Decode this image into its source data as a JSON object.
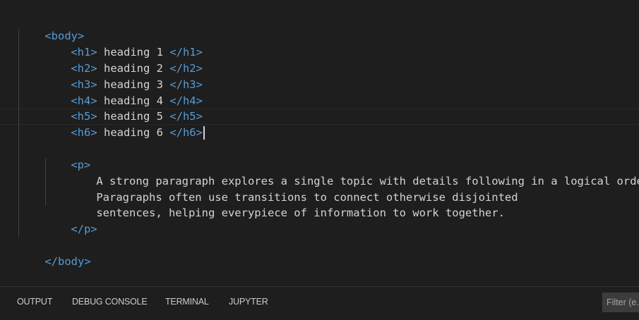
{
  "editor": {
    "lines": [
      {
        "open": "<body>"
      },
      {
        "open": "<h1>",
        "content": " heading 1 ",
        "close": "</h1>"
      },
      {
        "open": "<h2>",
        "content": " heading 2 ",
        "close": "</h2>"
      },
      {
        "open": "<h3>",
        "content": " heading 3 ",
        "close": "</h3>"
      },
      {
        "open": "<h4>",
        "content": " heading 4 ",
        "close": "</h4>"
      },
      {
        "open": "<h5>",
        "content": " heading 5 ",
        "close": "</h5>"
      },
      {
        "open": "<h6>",
        "content": " heading 6 ",
        "close": "</h6>"
      },
      {
        "open": "<p>"
      },
      {
        "content": "A strong paragraph explores a single topic with details following in a logical order."
      },
      {
        "content": "Paragraphs often use transitions to connect otherwise disjointed"
      },
      {
        "content": "sentences, helping everypiece of information to work together."
      },
      {
        "close": "</p>"
      },
      {
        "close": "</body>"
      }
    ]
  },
  "panel": {
    "tabs": [
      {
        "label": "OUTPUT"
      },
      {
        "label": "DEBUG CONSOLE"
      },
      {
        "label": "TERMINAL"
      },
      {
        "label": "JUPYTER"
      }
    ],
    "filter_placeholder": "Filter (e.g. text, !exclude)"
  },
  "colors": {
    "background": "#1e1e1e",
    "tag": "#569cd6",
    "text": "#d4d4d4",
    "panel_text": "#cccccc",
    "filter_bg": "#3c3c3c"
  }
}
